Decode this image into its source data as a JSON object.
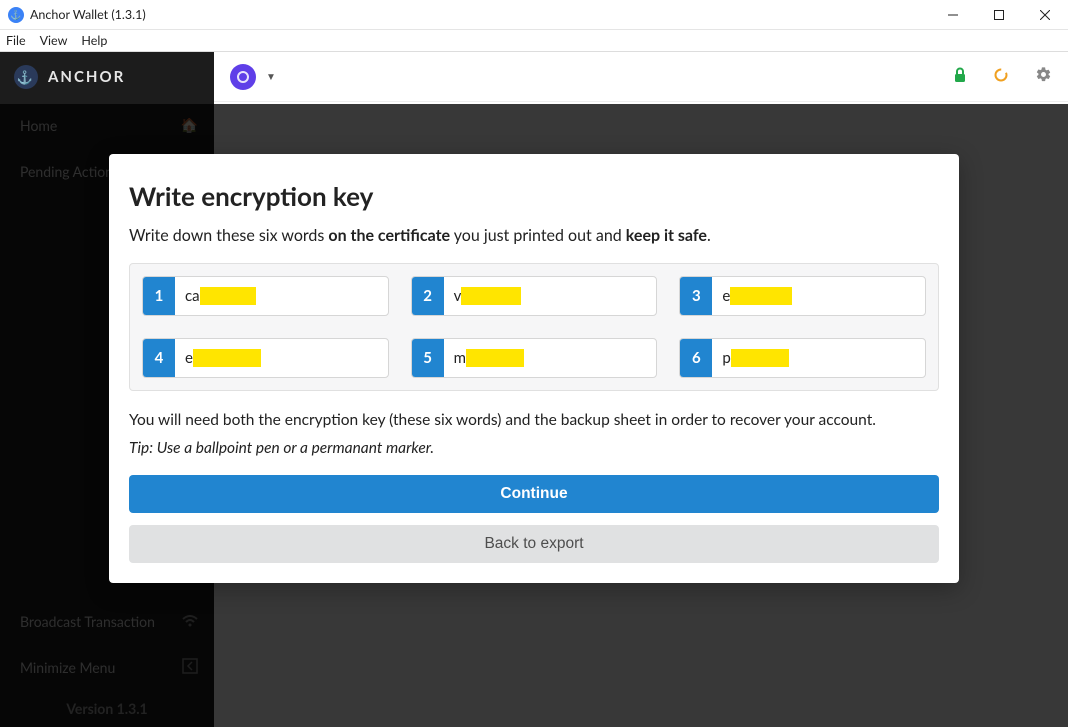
{
  "window": {
    "title": "Anchor Wallet (1.3.1)"
  },
  "menu": {
    "file": "File",
    "view": "View",
    "help": "Help"
  },
  "brand": {
    "name": "ANCHOR"
  },
  "sidebar": {
    "home": "Home",
    "pending": "Pending Actions",
    "broadcast": "Broadcast Transaction",
    "minimize": "Minimize Menu",
    "version": "Version 1.3.1"
  },
  "modal": {
    "title": "Write encryption key",
    "sub_prefix": "Write down these six words ",
    "sub_bold1": "on the certificate",
    "sub_mid": " you just printed out and ",
    "sub_bold2": "keep it safe",
    "sub_suffix": ".",
    "words": [
      {
        "n": "1",
        "prefix": "ca",
        "redact_w": 56
      },
      {
        "n": "2",
        "prefix": "v",
        "redact_w": 60
      },
      {
        "n": "3",
        "prefix": "e",
        "redact_w": 62
      },
      {
        "n": "4",
        "prefix": "e",
        "redact_w": 68
      },
      {
        "n": "5",
        "prefix": "m",
        "redact_w": 58
      },
      {
        "n": "6",
        "prefix": "p",
        "redact_w": 58
      }
    ],
    "note": "You will need both the encryption key (these six words) and the backup sheet in order to recover your account.",
    "tip": "Tip: Use a ballpoint pen or a permanant marker.",
    "continue": "Continue",
    "back": "Back to export"
  }
}
